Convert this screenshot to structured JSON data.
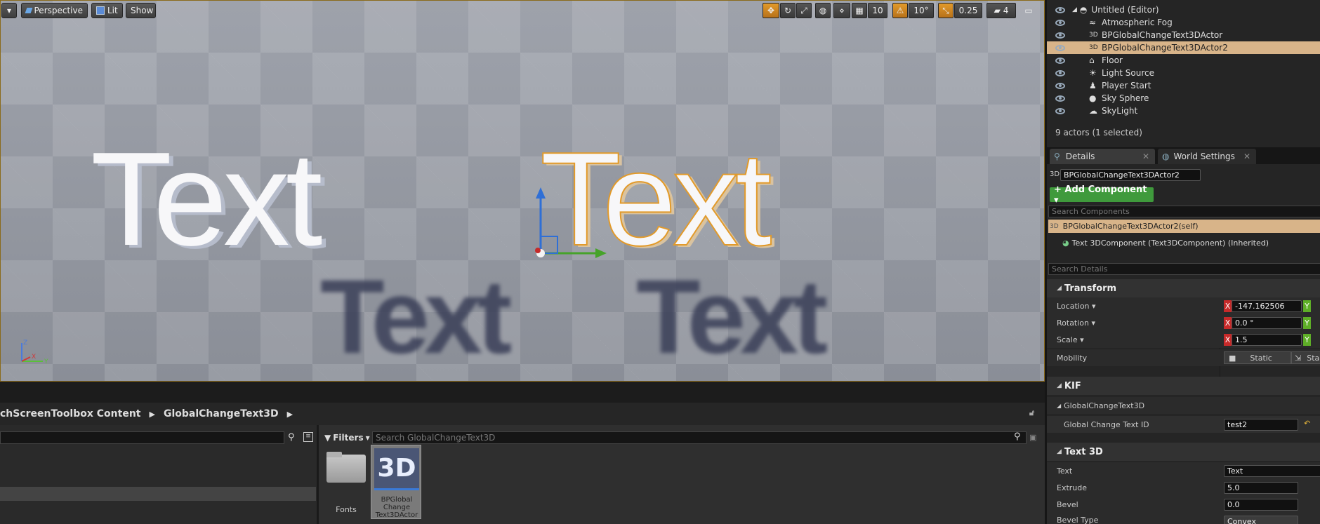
{
  "viewport": {
    "menu_arrow": "▾",
    "perspective_label": "Perspective",
    "lit_label": "Lit",
    "show_label": "Show",
    "grid_snap": "10",
    "rot_snap": "10°",
    "scale_snap": "0.25",
    "camera_speed": "4",
    "actor_text_left": "Text",
    "actor_text_right": "Text",
    "shadow_text_1": "Text",
    "shadow_text_2": "Text",
    "axis_z": "Z",
    "axis_x": "X",
    "axis_y": "Y"
  },
  "content_browser": {
    "breadcrumb_1": "chScreenToolbox Content",
    "breadcrumb_2": "GlobalChangeText3D",
    "filters_label": "Filters",
    "search_placeholder": "Search GlobalChangeText3D",
    "folder_label": "Fonts",
    "asset_icon_text": "3D",
    "asset_label_1": "BPGlobal",
    "asset_label_2": "Change",
    "asset_label_3": "Text3DActor"
  },
  "outliner": {
    "items": [
      {
        "label": "Untitled (Editor)"
      },
      {
        "label": "Atmospheric Fog"
      },
      {
        "label": "BPGlobalChangeText3DActor"
      },
      {
        "label": "BPGlobalChangeText3DActor2"
      },
      {
        "label": "Floor"
      },
      {
        "label": "Light Source"
      },
      {
        "label": "Player Start"
      },
      {
        "label": "Sky Sphere"
      },
      {
        "label": "SkyLight"
      }
    ],
    "status": "9 actors (1 selected)"
  },
  "details": {
    "tab_details": "Details",
    "tab_world": "World Settings",
    "actor_prefix": "3D",
    "actor_name": "BPGlobalChangeText3DActor2",
    "add_component": "+ Add Component ▾",
    "search_components": "Search Components",
    "component_self": "BPGlobalChangeText3DActor2(self)",
    "component_text": "Text 3DComponent (Text3DComponent) (Inherited)",
    "search_details": "Search Details",
    "transform_label": "Transform",
    "location_label": "Location ▾",
    "location_x": "-147.162506",
    "rotation_label": "Rotation ▾",
    "rotation_x": "0.0 °",
    "scale_label": "Scale ▾",
    "scale_x": "1.5",
    "mobility_label": "Mobility",
    "mobility_static": "Static",
    "mobility_stat2": "Sta",
    "x_tag": "X",
    "y_tag": "Y",
    "kif_label": "KIF",
    "gc_label": "GlobalChangeText3D",
    "gc_id_label": "Global Change Text ID",
    "gc_id_value": "test2",
    "text3d_label": "Text 3D",
    "text_label": "Text",
    "text_value": "Text",
    "extrude_label": "Extrude",
    "extrude_value": "5.0",
    "bevel_label": "Bevel",
    "bevel_value": "0.0",
    "beveltype_label": "Bevel Type",
    "beveltype_value": "Convex"
  }
}
